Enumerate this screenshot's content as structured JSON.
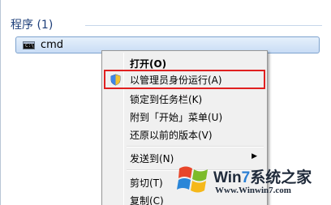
{
  "search_results": {
    "section_title": "程序 (1)",
    "items": [
      {
        "label": "cmd",
        "icon": "cmd-console-icon",
        "icon_text": "C:\\"
      }
    ]
  },
  "context_menu": {
    "items": [
      {
        "label": "打开(O)",
        "bold": true
      },
      {
        "label": "以管理员身份运行(A)",
        "icon": "uac-shield-icon",
        "highlighted": true
      },
      {
        "label": "锁定到任务栏(K)"
      },
      {
        "label": "附到「开始」菜单(U)"
      },
      {
        "label": "还原以前的版本(V)"
      },
      {
        "label": "发送到(N)",
        "submenu": true
      },
      {
        "label": "剪切(T)"
      },
      {
        "label": "复制(C)"
      }
    ],
    "highlight_color": "#e02020"
  },
  "watermark": {
    "title_prefix": "Win",
    "title_seven": "7",
    "title_suffix": "系统之家",
    "url": "Www.Winwin7.com"
  }
}
